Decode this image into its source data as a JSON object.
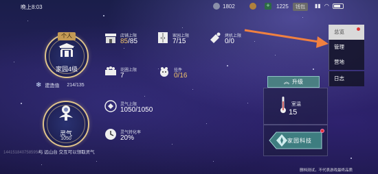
{
  "status_bar": {
    "time": "晚上8:03",
    "resource_1": "1802",
    "resource_2": "1225",
    "charge_label": "钱包",
    "battery_level": 0.6
  },
  "home": {
    "badge": "个人",
    "level_label": "家园4级",
    "build_label": "建造值",
    "build_value": "214/135"
  },
  "spirit": {
    "label": "灵气",
    "value": "1050",
    "hint": "与 远山台 交互可以领取灵气"
  },
  "stats": {
    "stall_limit": {
      "label": "店铺上限",
      "value_current": "85",
      "value_total": "/85"
    },
    "furniture_limit": {
      "label": "家园上限",
      "value": "7/15"
    },
    "roast_limit": {
      "label": "烤机上限",
      "value": "0/0"
    },
    "garden_limit": {
      "label": "花圃上限",
      "value": "7"
    },
    "pets": {
      "label": "挂件",
      "value": "0/16"
    },
    "spirit_limit": {
      "label": "灵气上限",
      "value": "1050/1050"
    },
    "spirit_rate": {
      "label": "灵气转化率",
      "value": "20%"
    }
  },
  "upgrade": {
    "label": "升级"
  },
  "temperature": {
    "label": "室温",
    "value": "15"
  },
  "tech": {
    "label": "家园科技"
  },
  "tabs": [
    {
      "label": "总览",
      "active": true
    },
    {
      "label": "管理",
      "active": false
    },
    {
      "label": "营地",
      "active": false
    },
    {
      "label": "日志",
      "active": false
    }
  ],
  "uid": "1441518407585956",
  "disclaimer": "删档测试，不代表游戏最终品质",
  "colors": {
    "accent_gold": "#f2c46a",
    "ring_gold": "#e0c48a",
    "arrow": "#f08040",
    "tab_active_bg": "#d9d9d9",
    "upgrade_bg": "#4a7f82"
  }
}
